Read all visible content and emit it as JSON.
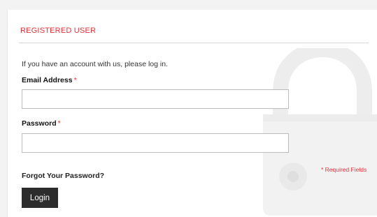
{
  "section": {
    "heading": "REGISTERED USER",
    "intro": "If you have an account with us, please log in."
  },
  "form": {
    "email": {
      "label": "Email Address",
      "required_mark": "*",
      "value": "",
      "placeholder": ""
    },
    "password": {
      "label": "Password",
      "required_mark": "*",
      "value": "",
      "placeholder": ""
    },
    "forgot_link": "Forgot Your Password?",
    "required_note": "* Required Fields",
    "login_button": "Login"
  },
  "colors": {
    "accent_red": "#e8333a",
    "button_bg": "#2c2c2c",
    "background": "#f3f3f3"
  },
  "decor": {
    "background_icon": "padlock-icon"
  }
}
